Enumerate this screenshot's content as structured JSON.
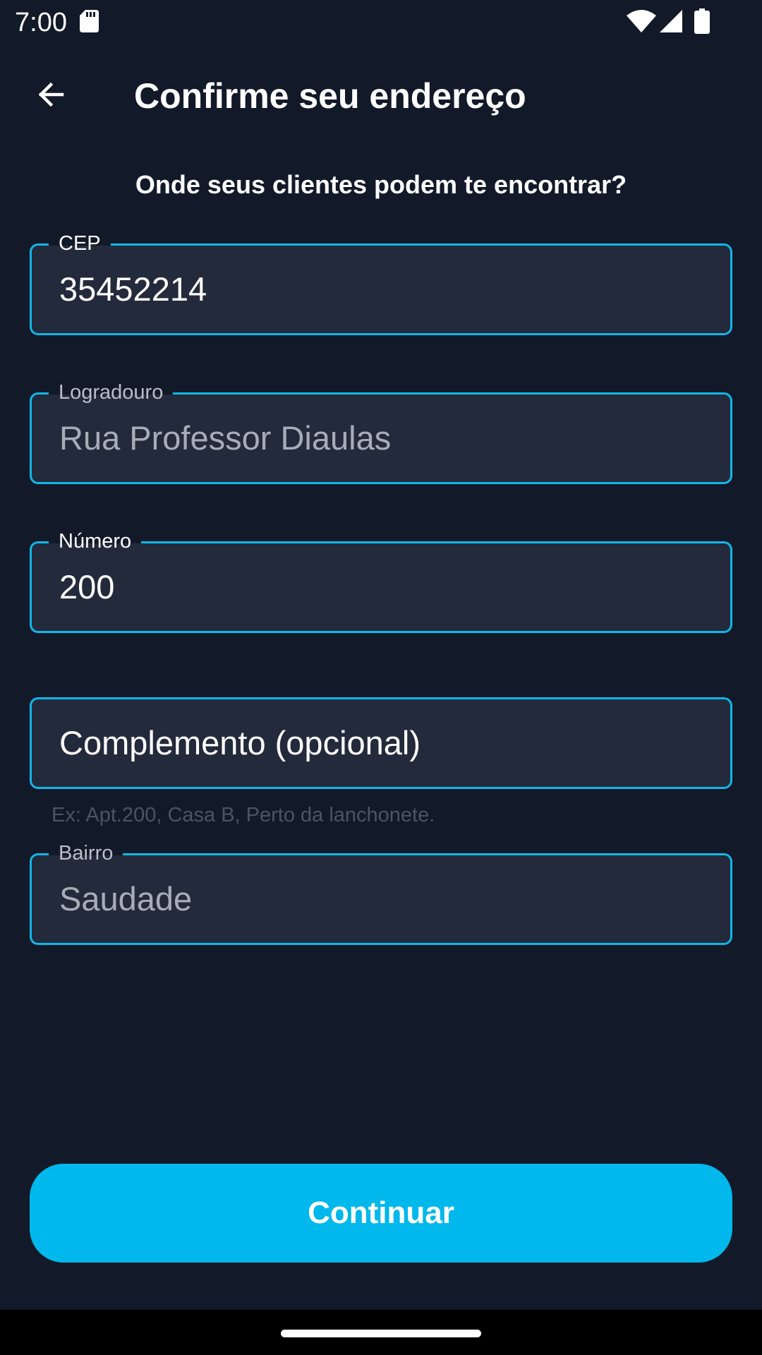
{
  "status_bar": {
    "time": "7:00",
    "icons": [
      "sd-card-icon",
      "wifi-icon",
      "cell-signal-icon",
      "battery-icon"
    ]
  },
  "app_bar": {
    "back_icon": "arrow-left-icon",
    "title": "Confirme seu endereço"
  },
  "subtitle": "Onde seus clientes podem te encontrar?",
  "form": {
    "cep": {
      "label": "CEP",
      "value": "35452214"
    },
    "logradouro": {
      "label": "Logradouro",
      "value": "Rua Professor Diaulas"
    },
    "numero": {
      "label": "Número",
      "value": "200"
    },
    "complemento": {
      "placeholder": "Complemento (opcional)",
      "helper": "Ex: Apt.200, Casa B, Perto da lanchonete."
    },
    "bairro": {
      "label": "Bairro",
      "value": "Saudade"
    }
  },
  "continue_button": {
    "label": "Continuar"
  },
  "colors": {
    "background": "#121929",
    "field_background": "#232a3b",
    "accent": "#10b7e8",
    "button": "#00b8ec"
  }
}
